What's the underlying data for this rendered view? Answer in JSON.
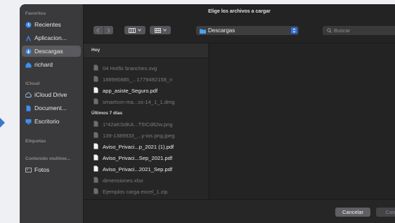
{
  "window": {
    "title": "Elige los archivos a cargar"
  },
  "sidebar": {
    "sections": [
      {
        "label": "Favoritos",
        "items": [
          {
            "label": "Recientes",
            "icon": "clock-icon",
            "selected": false
          },
          {
            "label": "Aplicacion...",
            "icon": "applications-icon",
            "selected": false
          },
          {
            "label": "Descargas",
            "icon": "downloads-icon",
            "selected": true
          },
          {
            "label": "richard",
            "icon": "home-icon",
            "selected": false
          }
        ]
      },
      {
        "label": "iCloud",
        "items": [
          {
            "label": "iCloud Drive",
            "icon": "cloud-icon",
            "selected": false
          },
          {
            "label": "Document...",
            "icon": "document-icon",
            "selected": false
          },
          {
            "label": "Escritorio",
            "icon": "desktop-icon",
            "selected": false
          }
        ]
      },
      {
        "label": "Etiquetas",
        "items": []
      },
      {
        "label": "Contenido multime...",
        "items": [
          {
            "label": "Fotos",
            "icon": "photos-icon",
            "selected": false
          }
        ]
      }
    ]
  },
  "toolbar": {
    "location": "Descargas",
    "search_placeholder": "Buscar"
  },
  "file_list": {
    "groups": [
      {
        "label": "Hoy",
        "files": [
          {
            "name": "04 Hotfix branches.svg",
            "enabled": false
          },
          {
            "name": "188990885_...1779492158_n",
            "enabled": false
          },
          {
            "name": "app_asiste_Seguro.pdf",
            "enabled": true
          },
          {
            "name": "smartsvn-ma...ss-14_1_1.dmg",
            "enabled": false
          }
        ]
      },
      {
        "label": "Últimos 7 días",
        "files": [
          {
            "name": "1*42aKSdKA...T5ICd82w.png",
            "enabled": false
          },
          {
            "name": "139-1389933_...y-ios.png.jpeg",
            "enabled": false
          },
          {
            "name": "Aviso_Privaci...p_2021 (1).pdf",
            "enabled": true
          },
          {
            "name": "Aviso_Privaci...Sep_2021.pdf",
            "enabled": true
          },
          {
            "name": "Aviso_Privaci...2021_Sep.pdf",
            "enabled": true
          },
          {
            "name": "dimensiones.xlsx",
            "enabled": false
          },
          {
            "name": "Ejemplos carga excel_1.zip",
            "enabled": false
          }
        ]
      }
    ]
  },
  "footer": {
    "cancel_label": "Cancelar",
    "load_label": "Cargar"
  },
  "colors": {
    "accent": "#2f6fdc",
    "sidebar_bg": "#3a3a3c",
    "window_bg": "#242424"
  }
}
